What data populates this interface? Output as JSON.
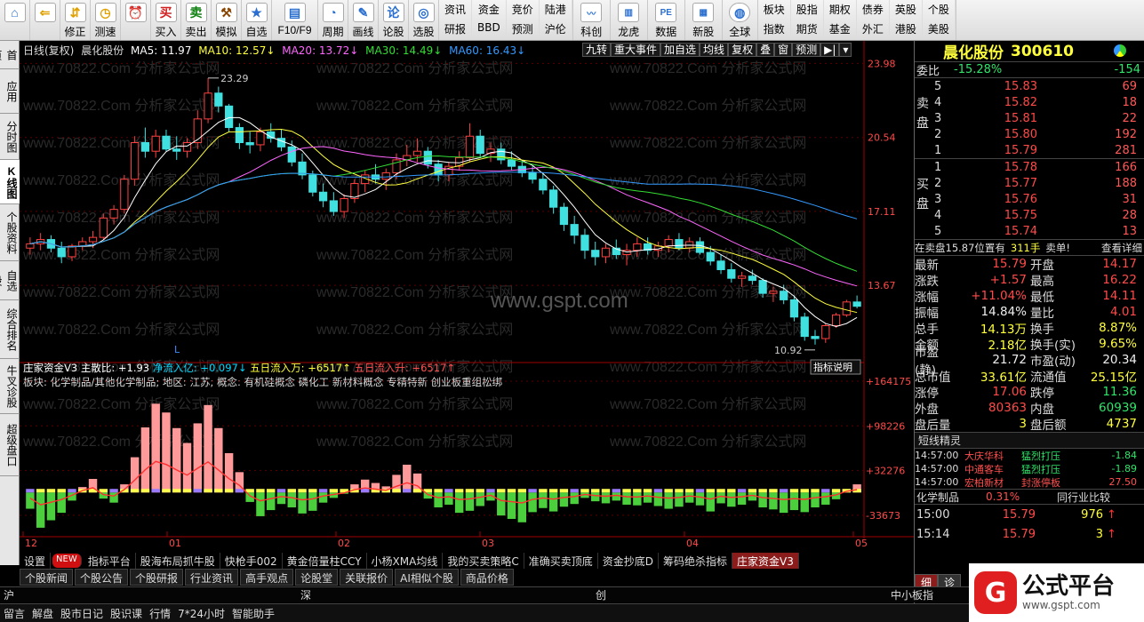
{
  "toolbar": {
    "buttons": [
      {
        "name": "home",
        "label": "",
        "icon": "⌂",
        "color": "#2a6fd0"
      },
      {
        "name": "back",
        "label": "",
        "icon": "⇐",
        "color": "#e0a000"
      },
      {
        "name": "correct",
        "label": "修正",
        "icon": "⇵",
        "color": "#e0a000"
      },
      {
        "name": "backtest",
        "label": "测速",
        "icon": "◷",
        "color": "#e0a000"
      },
      {
        "name": "clock",
        "label": "",
        "icon": "⏰",
        "color": "#555"
      },
      {
        "name": "buy",
        "label": "买入",
        "icon": "买",
        "color": "#d02020"
      },
      {
        "name": "sell",
        "label": "卖出",
        "icon": "卖",
        "color": "#108010"
      },
      {
        "name": "sim",
        "label": "模拟",
        "icon": "⚒",
        "color": "#884400"
      },
      {
        "name": "watch",
        "label": "自选",
        "icon": "★",
        "color": "#2a6fd0"
      },
      {
        "name": "f10",
        "label": "F10/F9",
        "icon": "▤",
        "color": "#2a6fd0"
      },
      {
        "name": "period",
        "label": "周期",
        "icon": "◔",
        "color": "#2a6fd0"
      },
      {
        "name": "draw",
        "label": "画线",
        "icon": "✎",
        "color": "#2a6fd0"
      },
      {
        "name": "stockcomment",
        "label": "论股",
        "icon": "论",
        "color": "#2a6fd0"
      },
      {
        "name": "pick",
        "label": "选股",
        "icon": "◎",
        "color": "#2a6fd0"
      }
    ],
    "grid1": [
      "资讯",
      "资金",
      "竞价",
      "陆港",
      "研报",
      "BBD",
      "预测",
      "沪伦"
    ],
    "grid2_labels": [
      "科创",
      "龙虎",
      "数据",
      "新股"
    ],
    "grid2_icons": [
      "〰",
      "▥",
      "PE",
      "▦"
    ],
    "globe_label": "全球",
    "grid3": [
      "板块",
      "股指",
      "期权",
      "债券",
      "英股",
      "个股",
      "指数",
      "期货",
      "基金",
      "外汇",
      "港股",
      "美股"
    ]
  },
  "left_tabs": [
    {
      "label": "首页",
      "active": false
    },
    {
      "label": "应用",
      "active": false
    },
    {
      "label": "分时图",
      "active": false
    },
    {
      "label": "K线图",
      "active": true
    },
    {
      "label": "个股资料",
      "active": false
    },
    {
      "label": "自选股",
      "active": false
    },
    {
      "label": "综合排名",
      "active": false
    },
    {
      "label": "牛叉诊股",
      "active": false
    },
    {
      "label": "超级盘口",
      "active": false
    }
  ],
  "chart_header": {
    "period": "日线(复权)",
    "stock": "晨化股份",
    "ma5": "MA5: 11.97",
    "ma10": "MA10: 12.57↓",
    "ma20": "MA20: 13.72↓",
    "ma30": "MA30: 14.49↓",
    "ma60": "MA60: 16.43↓"
  },
  "chart_buttons": [
    "九转",
    "重大事件",
    "加自选",
    "均线",
    "复权",
    "叠",
    "窗",
    "预测",
    "▶|",
    "▾"
  ],
  "price_axis": [
    "23.98",
    "20.54",
    "17.11",
    "13.67"
  ],
  "high_label": "23.29",
  "low_label": "10.92",
  "l_marker": "L",
  "indicator": {
    "name": "庄家资金V3",
    "line1": [
      {
        "t": "庄家资金V3",
        "c": "#ffffff"
      },
      {
        "t": " 主散比: +1.93 ",
        "c": "#ffffff"
      },
      {
        "t": "净流入亿: +0.097↓ ",
        "c": "#00d8ff"
      },
      {
        "t": "五日流入万: +6517↑ ",
        "c": "#ffff3c"
      },
      {
        "t": "五日流入升: +6517↑",
        "c": "#ff5050"
      }
    ],
    "line2": "板块: 化学制品/其他化学制品; 地区: 江苏; 概念: 有机硅概念  磷化工  新材料概念  专精特新  创业板重组松绑",
    "explain": "指标说明",
    "axis": [
      "+164175",
      "+98226",
      "+32276",
      "-33673"
    ]
  },
  "x_axis": [
    "12",
    "01",
    "02",
    "03",
    "04",
    "05"
  ],
  "watermark": "www.gspt.com",
  "watermark_repeat": "www.70822.Com 分析家公式网",
  "right_panel": {
    "title": "晨化股份",
    "code": "300610",
    "weibi_label": "委比",
    "weibi": "-15.28%",
    "weicha": "-154",
    "sell_label": [
      "卖",
      "盘"
    ],
    "buy_label": [
      "买",
      "盘"
    ],
    "sell": [
      {
        "lv": "5",
        "p": "15.83",
        "v": "69"
      },
      {
        "lv": "4",
        "p": "15.82",
        "v": "18"
      },
      {
        "lv": "3",
        "p": "15.81",
        "v": "22"
      },
      {
        "lv": "2",
        "p": "15.80",
        "v": "192"
      },
      {
        "lv": "1",
        "p": "15.79",
        "v": "281"
      }
    ],
    "buy": [
      {
        "lv": "1",
        "p": "15.78",
        "v": "166"
      },
      {
        "lv": "2",
        "p": "15.77",
        "v": "188"
      },
      {
        "lv": "3",
        "p": "15.76",
        "v": "31"
      },
      {
        "lv": "4",
        "p": "15.75",
        "v": "28"
      },
      {
        "lv": "5",
        "p": "15.74",
        "v": "13"
      }
    ],
    "pending": {
      "left": "在卖盘15.87位置有",
      "mid": "311手",
      "mid2": "卖单!",
      "right": "查看详细"
    },
    "quotes": [
      {
        "k1": "最新",
        "v1": "15.79",
        "c1": "red",
        "k2": "开盘",
        "v2": "14.17",
        "c2": "red"
      },
      {
        "k1": "涨跌",
        "v1": "+1.57",
        "c1": "red",
        "k2": "最高",
        "v2": "16.22",
        "c2": "red"
      },
      {
        "k1": "涨幅",
        "v1": "+11.04%",
        "c1": "red",
        "k2": "最低",
        "v2": "14.11",
        "c2": "red"
      },
      {
        "k1": "振幅",
        "v1": "14.84%",
        "c1": "white",
        "k2": "量比",
        "v2": "4.01",
        "c2": "red"
      },
      {
        "k1": "总手",
        "v1": "14.13万",
        "c1": "yellow",
        "k2": "换手",
        "v2": "8.87%",
        "c2": "yellow"
      },
      {
        "k1": "金额",
        "v1": "2.18亿",
        "c1": "yellow",
        "k2": "换手(实)",
        "v2": "9.65%",
        "c2": "yellow"
      },
      {
        "k1": "市盈(静)",
        "v1": "21.72",
        "c1": "white",
        "k2": "市盈(动)",
        "v2": "20.34",
        "c2": "white"
      },
      {
        "k1": "总市值",
        "v1": "33.61亿",
        "c1": "yellow",
        "k2": "流通值",
        "v2": "25.15亿",
        "c2": "yellow"
      },
      {
        "k1": "涨停",
        "v1": "17.06",
        "c1": "red",
        "k2": "跌停",
        "v2": "11.36",
        "c2": "green"
      },
      {
        "k1": "外盘",
        "v1": "80363",
        "c1": "red",
        "k2": "内盘",
        "v2": "60939",
        "c2": "green"
      },
      {
        "k1": "盘后量",
        "v1": "3",
        "c1": "yellow",
        "k2": "盘后额",
        "v2": "4737",
        "c2": "yellow"
      }
    ],
    "short_title": "短线精灵",
    "short": [
      {
        "t": "14:57:00",
        "n": "大庆华科",
        "e": "猛烈打压",
        "v": "-1.84"
      },
      {
        "t": "14:57:00",
        "n": "中通客车",
        "e": "猛烈打压",
        "v": "-1.89"
      },
      {
        "t": "14:57:00",
        "n": "宏柏新材",
        "e": "封涨停板",
        "v": "27.50"
      }
    ],
    "industry": {
      "name": "化学制品",
      "pct": "0.31%",
      "btn": "同行业比较"
    },
    "ticks": [
      {
        "t": "15:00",
        "p": "15.79",
        "v": "976"
      },
      {
        "t": "15:14",
        "p": "15.79",
        "v": "3"
      }
    ],
    "tick_tabs": [
      "细",
      "诊"
    ]
  },
  "indicator_tabs": [
    "设置",
    "NEW",
    "指标平台",
    "股海布局抓牛股",
    "快枪手002",
    "黄金倍量柱CCY",
    "小杨XMA均线",
    "我的买卖策略C",
    "准确买卖顶底",
    "资金抄底D",
    "筹码绝杀指标",
    "庄家资金V3"
  ],
  "news_tabs": [
    "个股新闻",
    "个股公告",
    "个股研报",
    "行业资讯",
    "高手观点",
    "论股堂",
    "关联报价",
    "AI相似个股",
    "商品价格"
  ],
  "index_bar": {
    "sh": "沪",
    "sz": "深",
    "cy": "创",
    "zx": "中小板指"
  },
  "status_bar": [
    "留言",
    "解盘",
    "股市日记",
    "股识课",
    "行情",
    "7*24小时",
    "智能助手"
  ],
  "brand": {
    "t1": "公式平台",
    "t2": "www.gspt.com"
  },
  "chart_data": {
    "type": "candlestick",
    "x_ticks": [
      "12",
      "01",
      "02",
      "03",
      "04",
      "05"
    ],
    "ylim": [
      10.5,
      24.2
    ],
    "candles": [
      [
        15.4,
        15.9,
        15.1,
        15.6
      ],
      [
        15.6,
        16.1,
        15.3,
        15.8
      ],
      [
        15.8,
        16.0,
        15.2,
        15.4
      ],
      [
        15.4,
        15.7,
        14.7,
        15.0
      ],
      [
        15.0,
        15.6,
        14.8,
        15.5
      ],
      [
        15.5,
        15.9,
        15.3,
        15.7
      ],
      [
        15.7,
        16.2,
        15.4,
        15.9
      ],
      [
        15.9,
        17.0,
        15.8,
        16.8
      ],
      [
        16.8,
        17.4,
        16.5,
        17.2
      ],
      [
        17.2,
        18.8,
        17.0,
        18.6
      ],
      [
        18.6,
        20.6,
        18.3,
        20.3
      ],
      [
        20.3,
        21.0,
        19.6,
        19.9
      ],
      [
        19.9,
        20.9,
        19.6,
        20.6
      ],
      [
        20.6,
        20.9,
        19.9,
        20.0
      ],
      [
        20.0,
        20.6,
        19.5,
        19.9
      ],
      [
        19.9,
        20.5,
        19.6,
        20.3
      ],
      [
        20.3,
        21.8,
        20.0,
        21.4
      ],
      [
        21.4,
        23.3,
        21.2,
        22.6
      ],
      [
        22.6,
        22.9,
        21.7,
        22.0
      ],
      [
        22.0,
        22.1,
        20.8,
        21.0
      ],
      [
        21.0,
        21.2,
        20.0,
        20.3
      ],
      [
        20.3,
        20.8,
        19.8,
        20.2
      ],
      [
        20.2,
        21.0,
        19.9,
        20.8
      ],
      [
        20.8,
        21.2,
        20.3,
        20.5
      ],
      [
        20.5,
        20.9,
        19.9,
        20.1
      ],
      [
        20.1,
        20.4,
        19.2,
        19.4
      ],
      [
        19.4,
        19.8,
        18.6,
        18.8
      ],
      [
        18.8,
        19.0,
        17.8,
        18.0
      ],
      [
        18.0,
        18.4,
        17.3,
        17.6
      ],
      [
        17.6,
        18.0,
        16.9,
        17.1
      ],
      [
        17.1,
        17.9,
        16.8,
        17.7
      ],
      [
        17.7,
        18.6,
        17.5,
        18.4
      ],
      [
        18.4,
        19.0,
        18.0,
        18.8
      ],
      [
        18.8,
        19.3,
        18.4,
        18.6
      ],
      [
        18.6,
        19.1,
        18.1,
        18.9
      ],
      [
        18.9,
        19.8,
        18.6,
        19.5
      ],
      [
        19.5,
        20.2,
        19.2,
        19.7
      ],
      [
        19.7,
        20.5,
        19.4,
        19.9
      ],
      [
        19.9,
        20.1,
        19.1,
        19.3
      ],
      [
        19.3,
        19.5,
        18.5,
        18.8
      ],
      [
        18.8,
        19.4,
        18.5,
        19.2
      ],
      [
        19.2,
        19.9,
        19.0,
        19.6
      ],
      [
        19.6,
        21.2,
        19.4,
        20.6
      ],
      [
        20.6,
        20.9,
        19.6,
        19.8
      ],
      [
        19.8,
        20.3,
        19.4,
        20.0
      ],
      [
        20.0,
        20.3,
        19.3,
        19.5
      ],
      [
        19.5,
        19.9,
        19.0,
        19.2
      ],
      [
        19.2,
        19.5,
        18.7,
        18.9
      ],
      [
        18.9,
        19.2,
        18.4,
        18.6
      ],
      [
        18.6,
        18.9,
        17.9,
        18.1
      ],
      [
        18.1,
        18.3,
        17.0,
        17.3
      ],
      [
        17.3,
        17.5,
        16.2,
        16.5
      ],
      [
        16.5,
        16.9,
        15.6,
        16.0
      ],
      [
        16.0,
        16.3,
        14.9,
        15.3
      ],
      [
        15.3,
        15.7,
        14.6,
        15.0
      ],
      [
        15.0,
        15.6,
        14.7,
        15.4
      ],
      [
        15.4,
        15.8,
        14.9,
        15.1
      ],
      [
        15.1,
        15.6,
        14.6,
        15.3
      ],
      [
        15.3,
        15.9,
        15.0,
        15.6
      ],
      [
        15.6,
        15.9,
        15.1,
        15.3
      ],
      [
        15.3,
        15.7,
        15.0,
        15.5
      ],
      [
        15.5,
        16.0,
        15.2,
        15.8
      ],
      [
        15.8,
        16.1,
        15.3,
        15.4
      ],
      [
        15.4,
        15.9,
        15.2,
        15.7
      ],
      [
        15.7,
        15.9,
        15.1,
        15.2
      ],
      [
        15.2,
        15.5,
        14.6,
        14.8
      ],
      [
        14.8,
        15.1,
        14.2,
        14.4
      ],
      [
        14.4,
        14.7,
        13.8,
        14.0
      ],
      [
        14.0,
        14.3,
        13.6,
        14.1
      ],
      [
        14.1,
        14.4,
        13.7,
        13.9
      ],
      [
        13.9,
        14.0,
        13.1,
        13.3
      ],
      [
        13.3,
        13.6,
        12.9,
        13.4
      ],
      [
        13.4,
        13.7,
        12.8,
        13.0
      ],
      [
        13.0,
        13.2,
        12.0,
        12.2
      ],
      [
        12.2,
        12.4,
        11.1,
        11.3
      ],
      [
        11.3,
        11.6,
        10.92,
        11.2
      ],
      [
        11.2,
        11.9,
        11.0,
        11.8
      ],
      [
        11.8,
        12.4,
        11.7,
        12.3
      ],
      [
        12.3,
        13.0,
        12.2,
        12.9
      ],
      [
        12.9,
        13.2,
        12.6,
        12.7
      ]
    ],
    "indicator_values": [
      -24000,
      -52000,
      -41000,
      -30000,
      -12000,
      8000,
      20000,
      -9000,
      -15000,
      12000,
      52000,
      96000,
      131000,
      118000,
      95000,
      73000,
      102000,
      129000,
      95000,
      58000,
      30000,
      -14000,
      -35000,
      -26000,
      -17000,
      -22000,
      -31000,
      -27000,
      -15000,
      -8000,
      -2000,
      12000,
      19000,
      14000,
      9000,
      26000,
      41000,
      28000,
      -9000,
      -22000,
      -18000,
      -30000,
      -27000,
      -20000,
      -12000,
      -34000,
      -39000,
      -44000,
      -29000,
      -23000,
      -28000,
      -21000,
      -17000,
      -8000,
      -13000,
      -16000,
      -12000,
      -18000,
      -19000,
      -15000,
      -20000,
      -24000,
      -21000,
      -15000,
      -19000,
      -28000,
      -16000,
      -21000,
      -18000,
      -12000,
      -22000,
      -25000,
      -30000,
      -26000,
      -29000,
      -22000,
      -18000,
      -10000,
      5000,
      12000
    ],
    "ma_series": [
      "MA5",
      "MA10",
      "MA20",
      "MA30",
      "MA60"
    ],
    "ma_colors": [
      "#ffffff",
      "#ffff3c",
      "#ff66ff",
      "#33dd33",
      "#3399ff"
    ]
  }
}
